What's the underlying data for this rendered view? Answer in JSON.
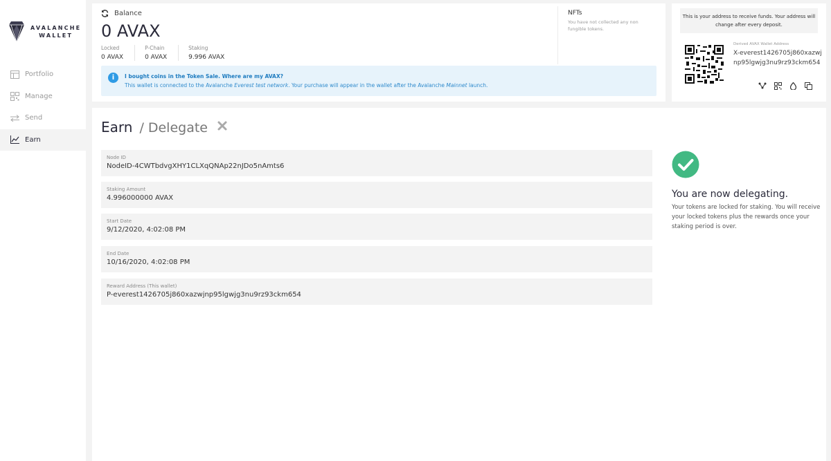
{
  "brand": {
    "line1": "AVALANCHE",
    "line2": "WALLET"
  },
  "nav": [
    {
      "label": "Portfolio",
      "icon": "portfolio-icon",
      "active": false
    },
    {
      "label": "Manage",
      "icon": "manage-icon",
      "active": false
    },
    {
      "label": "Send",
      "icon": "send-icon",
      "active": false
    },
    {
      "label": "Earn",
      "icon": "earn-icon",
      "active": true
    }
  ],
  "balance": {
    "label": "Balance",
    "value": "0 AVAX",
    "breakdown": [
      {
        "label": "Locked",
        "value": "0 AVAX"
      },
      {
        "label": "P-Chain",
        "value": "0 AVAX"
      },
      {
        "label": "Staking",
        "value": "9.996 AVAX"
      }
    ]
  },
  "nfts": {
    "title": "NFTs",
    "subtitle": "You have not collected any non fungible tokens."
  },
  "info": {
    "title": "I bought coins in the Token Sale. Where are my AVAX?",
    "body_prefix": "This wallet is connected to the Avalanche ",
    "body_em1": "Everest test network",
    "body_mid": ". Your purchase will appear in the wallet after the Avalanche ",
    "body_em2": "Mainnet",
    "body_suffix": " launch."
  },
  "address": {
    "note": "This is your address to receive funds. Your address will change after every deposit.",
    "label": "Derived AVAX Wallet Address",
    "value": "X-everest1426705j860xazwjnp95lgwjg3nu9rz93ckm654"
  },
  "page": {
    "title": "Earn",
    "separator": "/",
    "subtitle": "Delegate"
  },
  "fields": [
    {
      "label": "Node ID",
      "value": "NodeID-4CWTbdvgXHY1CLXqQNAp22nJDo5nAmts6"
    },
    {
      "label": "Staking Amount",
      "value": "4.996000000 AVAX"
    },
    {
      "label": "Start Date",
      "value": "9/12/2020, 4:02:08 PM"
    },
    {
      "label": "End Date",
      "value": "10/16/2020, 4:02:08 PM"
    },
    {
      "label": "Reward Address (This wallet)",
      "value": "P-everest1426705j860xazwjnp95lgwjg3nu9rz93ckm654"
    }
  ],
  "success": {
    "title": "You are now delegating.",
    "body": "Your tokens are locked for staking. You will receive your locked tokens plus the rewards once your staking period is over."
  },
  "colors": {
    "accent": "#42b983",
    "info_bg": "#e7f3fb",
    "info_text": "#2f8acc",
    "text_primary": "#2a2a3a"
  }
}
